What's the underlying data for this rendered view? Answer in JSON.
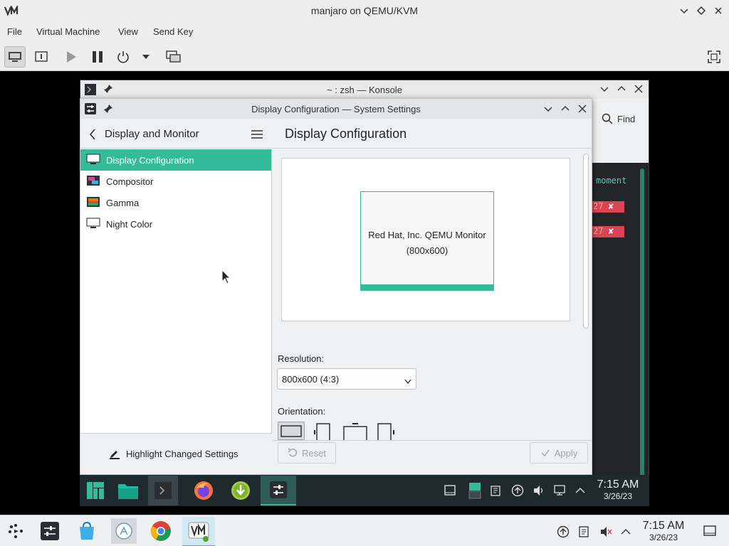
{
  "host_window": {
    "title": "manjaro on QEMU/KVM",
    "menu": [
      "File",
      "Virtual Machine",
      "View",
      "Send Key"
    ]
  },
  "konsole": {
    "title": "~ : zsh — Konsole",
    "find_label": "Find",
    "term_text_1": "moment",
    "term_badge": "27"
  },
  "settings": {
    "title": "Display Configuration — System Settings",
    "sidebar_title": "Display and Monitor",
    "items": [
      {
        "label": "Display Configuration",
        "icon": "monitor-icon"
      },
      {
        "label": "Compositor",
        "icon": "compositor-icon"
      },
      {
        "label": "Gamma",
        "icon": "gamma-icon"
      },
      {
        "label": "Night Color",
        "icon": "monitor-icon"
      }
    ],
    "highlight_label": "Highlight Changed Settings",
    "page_title": "Display Configuration",
    "monitor_name": "Red Hat, Inc. QEMU Monitor",
    "monitor_res": "(800x600)",
    "resolution_label": "Resolution:",
    "resolution_value": "800x600 (4:3)",
    "orientation_label": "Orientation:",
    "reset_label": "Reset",
    "apply_label": "Apply"
  },
  "guest_panel": {
    "time": "7:15 AM",
    "date": "3/26/23"
  },
  "host_taskbar": {
    "time": "7:15 AM",
    "date": "3/26/23"
  },
  "colors": {
    "accent": "#34bc9a",
    "panel": "#1f2a2e",
    "error_badge": "#da4453"
  }
}
